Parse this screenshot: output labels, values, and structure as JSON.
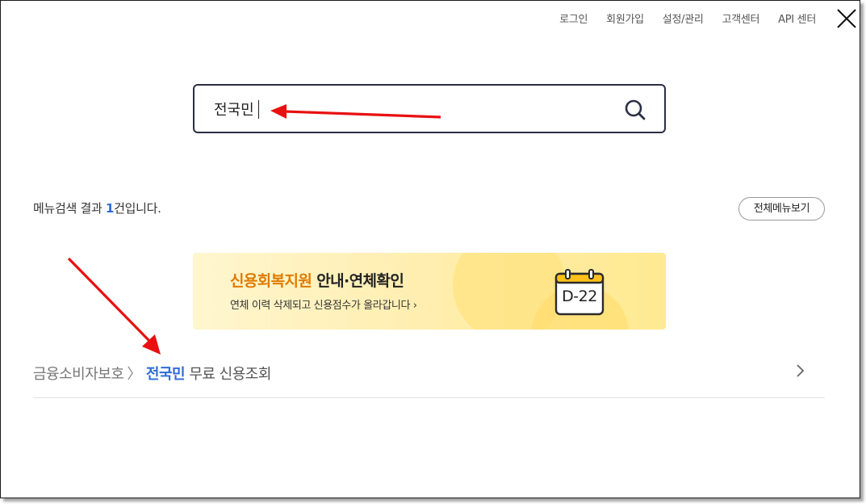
{
  "topnav": {
    "items": [
      "로그인",
      "회원가입",
      "설정/관리",
      "고객센터",
      "API 센터"
    ]
  },
  "search": {
    "value": "전국민",
    "placeholder": ""
  },
  "results": {
    "prefix": "메뉴검색 결과 ",
    "count": "1",
    "suffix": "건입니다.",
    "all_menu_label": "전체메뉴보기"
  },
  "banner": {
    "title_highlight": "신용회복지원",
    "title_rest": " 안내·연체확인",
    "subtitle": "연체 이력 삭제되고 신용점수가 올라갑니다 ›",
    "dday": "D-22"
  },
  "result_item": {
    "category": "금융소비자보호",
    "separator": "〉",
    "match": "전국민",
    "rest": " 무료 신용조회"
  },
  "colors": {
    "accent_blue": "#2c6bd6",
    "banner_orange": "#e07a00",
    "annotation_red": "#e81010"
  },
  "icons": {
    "close": "close-icon",
    "search": "search-icon",
    "calendar": "calendar-icon",
    "chevron": "chevron-right-icon"
  }
}
